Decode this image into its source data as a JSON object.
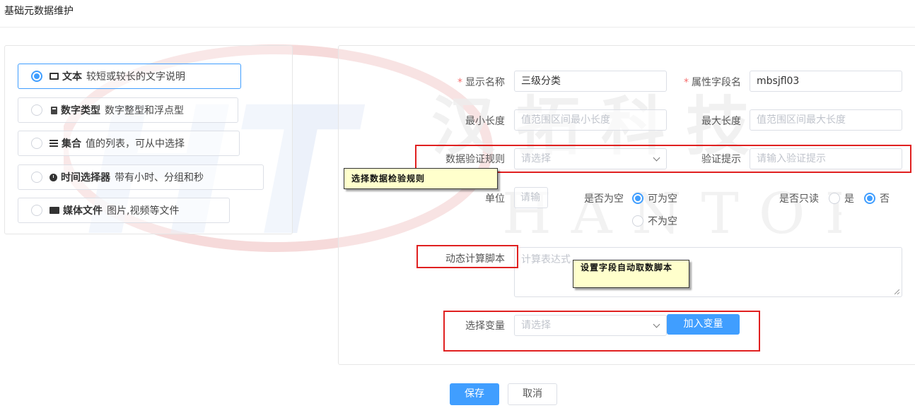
{
  "page": {
    "title": "基础元数据维护"
  },
  "type_options": [
    {
      "name": "文本",
      "desc": "较短或较长的文字说明",
      "icon": "text-frame-icon",
      "selected": true
    },
    {
      "name": "数字类型",
      "desc": "数字整型和浮点型",
      "icon": "calculator-icon",
      "selected": false
    },
    {
      "name": "集合",
      "desc": "值的列表，可从中选择",
      "icon": "list-icon",
      "selected": false
    },
    {
      "name": "时间选择器",
      "desc": "带有小时、分组和秒",
      "icon": "clock-icon",
      "selected": false
    },
    {
      "name": "媒体文件",
      "desc": "图片,视频等文件",
      "icon": "media-icon",
      "selected": false
    }
  ],
  "form": {
    "display_name": {
      "label": "显示名称",
      "value": "三级分类",
      "required": "*"
    },
    "field_name": {
      "label": "属性字段名",
      "value": "mbsjfl03",
      "required": "*"
    },
    "min_length": {
      "label": "最小长度",
      "placeholder": "值范围区间最小长度"
    },
    "max_length": {
      "label": "最大长度",
      "placeholder": "值范围区间最大长度"
    },
    "validation_rule": {
      "label": "数据验证规则",
      "placeholder": "请选择"
    },
    "validation_hint": {
      "label": "验证提示",
      "placeholder": "请输入验证提示"
    },
    "unit": {
      "label": "单位",
      "placeholder": "请输"
    },
    "nullable": {
      "label": "是否为空",
      "options": [
        "可为空",
        "不为空"
      ],
      "selected": "可为空"
    },
    "readonly": {
      "label": "是否只读",
      "options": [
        "是",
        "否"
      ],
      "selected": "否"
    },
    "script": {
      "label": "动态计算脚本",
      "placeholder": "计算表达式"
    },
    "variable": {
      "label": "选择变量",
      "placeholder": "请选择",
      "add_button": "加入变量"
    }
  },
  "footer": {
    "save": "保存",
    "cancel": "取消"
  },
  "annotations": {
    "rule_note": "选择数据检验规则",
    "script_note": "设置字段自动取数脚本"
  },
  "watermark": {
    "cn": "汉拓科技",
    "en": "HANTOP",
    "logo": "HT"
  },
  "colors": {
    "primary": "#409eff",
    "annotation_red": "#e02020",
    "note_bg": "#ffffcc",
    "required": "#f56c6c"
  }
}
